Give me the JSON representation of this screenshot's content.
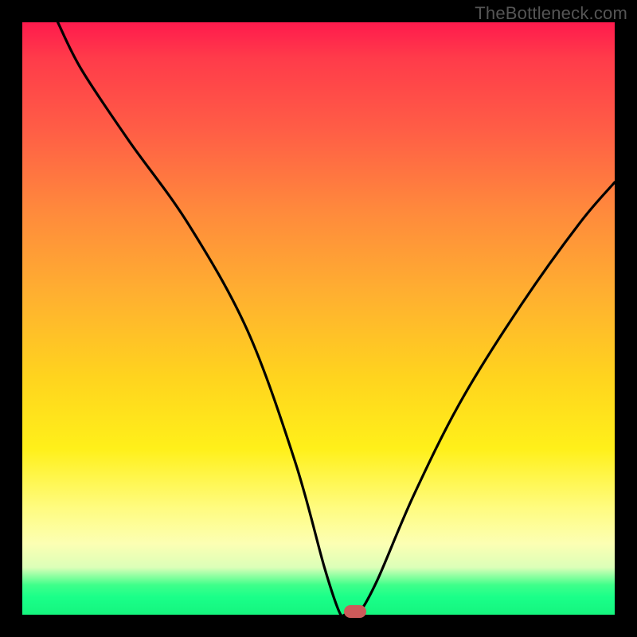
{
  "watermark": "TheBottleneck.com",
  "chart_data": {
    "type": "line",
    "title": "",
    "xlabel": "",
    "ylabel": "",
    "xlim": [
      0,
      100
    ],
    "ylim": [
      0,
      100
    ],
    "series": [
      {
        "name": "bottleneck-curve",
        "x": [
          6,
          10,
          18,
          28,
          38,
          46,
          51,
          53.5,
          54.5,
          55.5,
          57,
          60,
          66,
          74,
          84,
          94,
          100
        ],
        "values": [
          100,
          92,
          80,
          66,
          48,
          26,
          8,
          0.5,
          0,
          0,
          0.5,
          6,
          20,
          36,
          52,
          66,
          73
        ]
      }
    ],
    "marker": {
      "x": 56.2,
      "y": 0.5,
      "name": "optimal-point"
    },
    "background_gradient": {
      "stops": [
        {
          "pos": 0,
          "color": "#ff1a4d"
        },
        {
          "pos": 46,
          "color": "#ffb030"
        },
        {
          "pos": 72,
          "color": "#fff01a"
        },
        {
          "pos": 95,
          "color": "#3eff8a"
        },
        {
          "pos": 100,
          "color": "#15f57e"
        }
      ]
    }
  }
}
